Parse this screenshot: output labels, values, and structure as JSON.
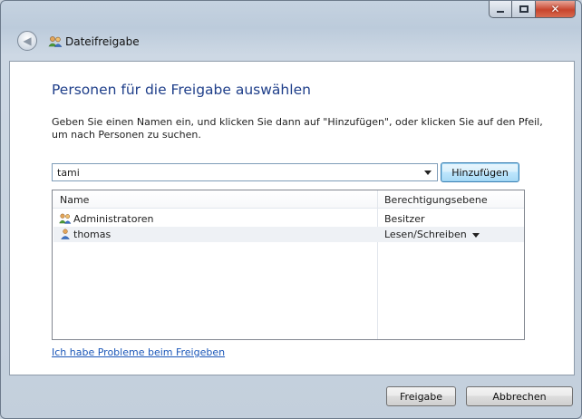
{
  "window": {
    "title": "Dateifreigabe",
    "caption_buttons": {
      "minimize": "minimize-icon",
      "maximize": "maximize-icon",
      "close": "close-icon"
    }
  },
  "main": {
    "heading": "Personen für die Freigabe auswählen",
    "description": "Geben Sie einen Namen ein, und klicken Sie dann auf \"Hinzufügen\", oder klicken Sie auf den Pfeil, um nach Personen zu suchen.",
    "name_input": {
      "value": "tami"
    },
    "add_button": "Hinzufügen",
    "list": {
      "columns": [
        "Name",
        "Berechtigungsebene"
      ],
      "rows": [
        {
          "name": "Administratoren",
          "permission": "Besitzer",
          "icon": "group-icon",
          "selected": false
        },
        {
          "name": "thomas",
          "permission": "Lesen/Schreiben",
          "icon": "user-icon",
          "selected": true
        }
      ]
    },
    "help_link": "Ich habe Probleme beim Freigeben"
  },
  "footer": {
    "share_button": "Freigabe",
    "cancel_button": "Abbrechen"
  },
  "colors": {
    "heading": "#1f3f8a",
    "link": "#1a56b8",
    "frame": "#c3cfdc",
    "close_button": "#c8452d"
  }
}
